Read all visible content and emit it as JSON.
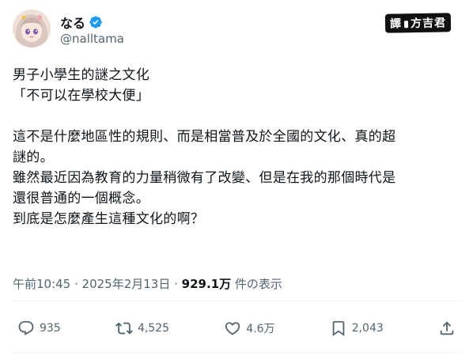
{
  "author": {
    "display_name": "なる",
    "handle": "@nalltama",
    "verified_icon": "verified-badge-icon",
    "avatar_icon": "avatar-anime-girl"
  },
  "credit": {
    "text_left": "譯",
    "text_right": "方吉君"
  },
  "post": {
    "line1": "男子小學生的謎之文化",
    "line2": "「不可以在學校大便」",
    "line3": "這不是什麼地區性的規則、而是相當普及於全國的文化、真的超",
    "line4": "謎的。",
    "line5": "雖然最近因為教育的力量稍微有了改變、但是在我的那個時代是",
    "line6": "還很普通的一個概念。",
    "line7": "到底是怎麼產生這種文化的啊？"
  },
  "meta": {
    "time": "午前10:45",
    "sep1": " · ",
    "date": "2025年2月13日",
    "sep2": " · ",
    "views_count": "929.1万",
    "views_label": " 件の表示"
  },
  "actions": {
    "reply_count": "935",
    "repost_count": "4,525",
    "like_count": "4.6万",
    "bookmark_count": "2,043"
  },
  "colors": {
    "text": "#0f1419",
    "secondary": "#536471",
    "verified": "#1d9bf0",
    "divider": "#eff3f4"
  }
}
